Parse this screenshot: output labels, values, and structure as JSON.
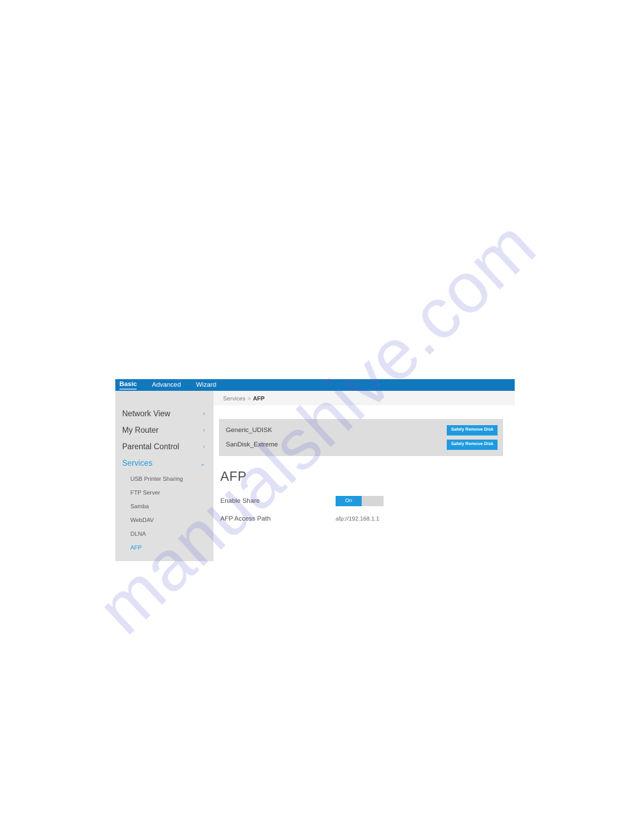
{
  "watermark": {
    "text": "manualshive.com"
  },
  "top_nav": {
    "tabs": [
      {
        "label": "Basic",
        "active": true
      },
      {
        "label": "Advanced",
        "active": false
      },
      {
        "label": "Wizard",
        "active": false
      }
    ]
  },
  "breadcrumb": {
    "parent": "Services",
    "separator": ">",
    "current": "AFP"
  },
  "sidebar": {
    "groups": [
      {
        "label": "Network View",
        "chevron": "chevron-right-icon",
        "expanded": false
      },
      {
        "label": "My Router",
        "chevron": "chevron-right-icon",
        "expanded": false
      },
      {
        "label": "Parental Control",
        "chevron": "chevron-right-icon",
        "expanded": false
      },
      {
        "label": "Services",
        "chevron": "chevron-down-icon",
        "expanded": true
      }
    ],
    "chevron_right_glyph": "›",
    "chevron_down_glyph": "⌄",
    "sub_items": [
      {
        "label": "USB Printer Sharing",
        "active": false
      },
      {
        "label": "FTP Server",
        "active": false
      },
      {
        "label": "Samba",
        "active": false
      },
      {
        "label": "WebDAV",
        "active": false
      },
      {
        "label": "DLNA",
        "active": false
      },
      {
        "label": "AFP",
        "active": true
      }
    ]
  },
  "disk_panel": {
    "disks": [
      {
        "name": "Generic_UDISK",
        "action_label": "Safely Remove Disk"
      },
      {
        "name": "SanDisk_Extreme",
        "action_label": "Safely Remove Disk"
      }
    ]
  },
  "afp": {
    "heading": "AFP",
    "enable_share_label": "Enable Share",
    "enable_share_state": "On",
    "access_path_label": "AFP Access Path",
    "access_path_value": "afp://192.168.1.1"
  },
  "colors": {
    "nav_blue": "#1278bd",
    "accent_blue": "#1e9ae0",
    "sidebar_grey": "#e0e0e0",
    "panel_grey": "#dddddd",
    "breadcrumb_grey": "#f4f4f4",
    "toggle_off_grey": "#d6d6d6"
  }
}
